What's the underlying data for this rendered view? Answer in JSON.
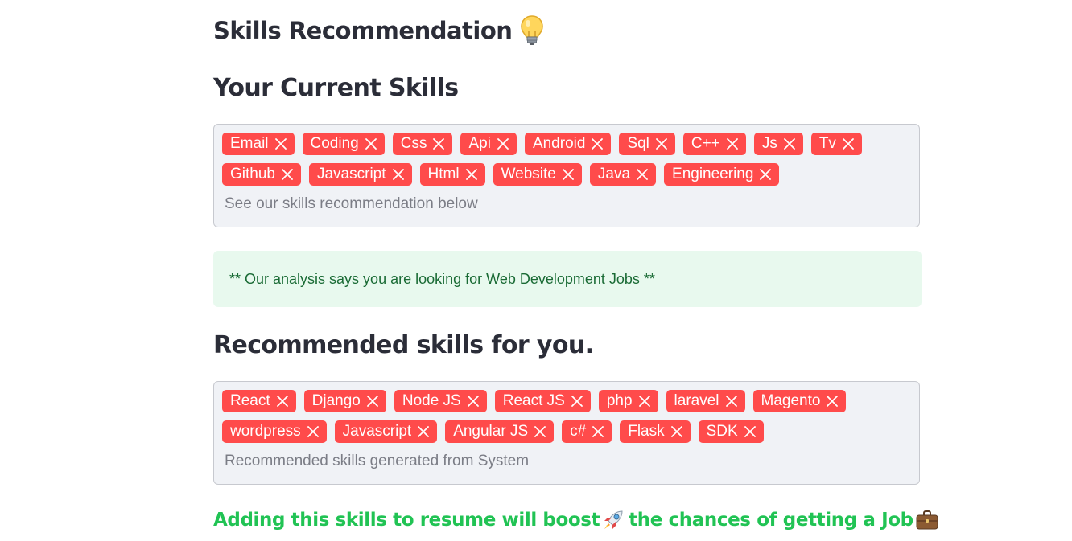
{
  "page": {
    "title": "Skills Recommendation",
    "title_icon": "lightbulb-icon",
    "current_skills_heading": "Your Current Skills",
    "current_skills": [
      "Email",
      "Coding",
      "Css",
      "Api",
      "Android",
      "Sql",
      "C++",
      "Js",
      "Tv",
      "Github",
      "Javascript",
      "Html",
      "Website",
      "Java",
      "Engineering"
    ],
    "current_skills_placeholder": "See our skills recommendation below",
    "analysis_message": "** Our analysis says you are looking for Web Development Jobs **",
    "recommended_heading": "Recommended skills for you.",
    "recommended_skills": [
      "React",
      "Django",
      "Node JS",
      "React JS",
      "php",
      "laravel",
      "Magento",
      "wordpress",
      "Javascript",
      "Angular JS",
      "c#",
      "Flask",
      "SDK"
    ],
    "recommended_placeholder": "Recommended skills generated from System",
    "boost_text_part1": "Adding this skills to resume will boost",
    "boost_text_part2": " the chances of getting a Job",
    "boost_icons": [
      "rocket-icon",
      "briefcase-icon"
    ]
  },
  "colors": {
    "tag_bg": "#ff4b4b",
    "box_bg": "#f0f2f6",
    "info_bg": "#e8f9ee",
    "info_text": "#1a6b35",
    "boost_text": "#21c354",
    "heading_text": "#2b2d38"
  }
}
